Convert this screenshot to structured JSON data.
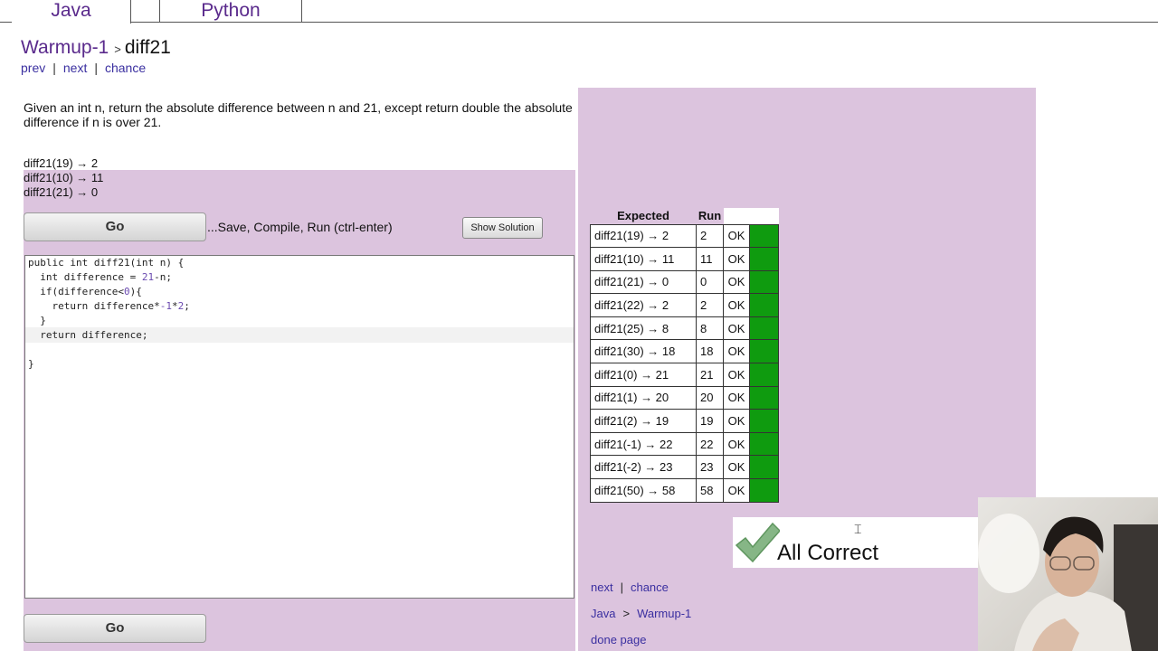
{
  "tabs": {
    "java": "Java",
    "python": "Python"
  },
  "breadcrumb": {
    "category": "Warmup-1",
    "separator": ">",
    "problem": "diff21"
  },
  "nav": {
    "prev": "prev",
    "next": "next",
    "chance": "chance",
    "bar": "|"
  },
  "description": "Given an int n, return the absolute difference between n and 21, except return double the absolute difference if n is over 21.",
  "examples": [
    "diff21(19) → 2",
    "diff21(10) → 11",
    "diff21(21) → 0"
  ],
  "toolbar": {
    "go_label": "Go",
    "save_hint": "...Save, Compile, Run (ctrl-enter)",
    "show_solution_label": "Show Solution"
  },
  "code": {
    "line1": "public int diff21(int n) {",
    "line2_a": "  int difference = ",
    "line2_b": "21",
    "line2_c": "-n;",
    "line3_a": "  if(difference<",
    "line3_b": "0",
    "line3_c": "){",
    "line4_a": "    return difference*",
    "line4_b": "-1",
    "line4_c": "*",
    "line4_d": "2",
    "line4_e": ";",
    "line5": "  }",
    "line6": "  return difference;",
    "line7": "",
    "line8": "}"
  },
  "results": {
    "headers": {
      "expected": "Expected",
      "run": "Run"
    },
    "rows": [
      {
        "expected": "diff21(19) → 2",
        "run": "2",
        "status": "OK"
      },
      {
        "expected": "diff21(10) → 11",
        "run": "11",
        "status": "OK"
      },
      {
        "expected": "diff21(21) → 0",
        "run": "0",
        "status": "OK"
      },
      {
        "expected": "diff21(22) → 2",
        "run": "2",
        "status": "OK"
      },
      {
        "expected": "diff21(25) → 8",
        "run": "8",
        "status": "OK"
      },
      {
        "expected": "diff21(30) → 18",
        "run": "18",
        "status": "OK"
      },
      {
        "expected": "diff21(0) → 21",
        "run": "21",
        "status": "OK"
      },
      {
        "expected": "diff21(1) → 20",
        "run": "20",
        "status": "OK"
      },
      {
        "expected": "diff21(2) → 19",
        "run": "19",
        "status": "OK"
      },
      {
        "expected": "diff21(-1) → 22",
        "run": "22",
        "status": "OK"
      },
      {
        "expected": "diff21(-2) → 23",
        "run": "23",
        "status": "OK"
      },
      {
        "expected": "diff21(50) → 58",
        "run": "58",
        "status": "OK"
      }
    ],
    "pass_color": "#0f9b0f"
  },
  "all_correct": "All Correct",
  "footer": {
    "next": "next",
    "chance": "chance",
    "lang": "Java",
    "gt": ">",
    "category": "Warmup-1",
    "done": "done page"
  },
  "colors": {
    "panel": "#dcc4de",
    "link": "#3a2fa0",
    "tab": "#5a2a8c"
  }
}
